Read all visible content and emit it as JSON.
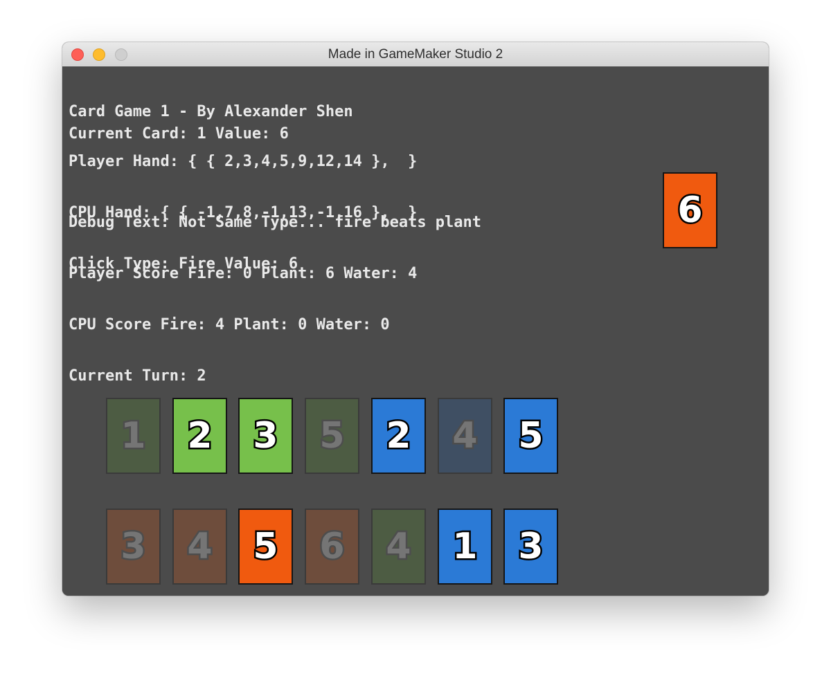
{
  "window": {
    "title": "Made in GameMaker Studio 2"
  },
  "hud": {
    "game_title": "Card Game 1 - By Alexander Shen",
    "current_card": "Current Card: 1 Value: 6",
    "player_hand": "Player Hand: { { 2,3,4,5,9,12,14 },  }",
    "cpu_hand": "CPU Hand: { { -1,7,8,-1,13,-1,16 },  }",
    "click_type": "Click Type: Fire Value: 6",
    "debug_text": "Debug Text: Not Same Type... fire beats plant",
    "player_score": "Player Score Fire: 0 Plant: 6 Water: 4",
    "cpu_score": "CPU Score Fire: 4 Plant: 0 Water: 0",
    "current_turn": "Current Turn: 2"
  },
  "colors": {
    "background": "#4b4b4b",
    "fire": "#f05a0f",
    "plant": "#77c04b",
    "water": "#2b7ad6",
    "fire_dim": "#6e4d3c",
    "plant_dim": "#4d5c43",
    "water_dim": "#3f4f63"
  },
  "played_card": {
    "type": "fire",
    "value": "6",
    "dimmed": false
  },
  "top_row_cards": [
    {
      "type": "plant",
      "value": "1",
      "dimmed": true
    },
    {
      "type": "plant",
      "value": "2",
      "dimmed": false
    },
    {
      "type": "plant",
      "value": "3",
      "dimmed": false
    },
    {
      "type": "plant",
      "value": "5",
      "dimmed": true
    },
    {
      "type": "water",
      "value": "2",
      "dimmed": false
    },
    {
      "type": "water",
      "value": "4",
      "dimmed": true
    },
    {
      "type": "water",
      "value": "5",
      "dimmed": false
    }
  ],
  "bottom_row_cards": [
    {
      "type": "fire",
      "value": "3",
      "dimmed": true
    },
    {
      "type": "fire",
      "value": "4",
      "dimmed": true
    },
    {
      "type": "fire",
      "value": "5",
      "dimmed": false
    },
    {
      "type": "fire",
      "value": "6",
      "dimmed": true
    },
    {
      "type": "plant",
      "value": "4",
      "dimmed": true
    },
    {
      "type": "water",
      "value": "1",
      "dimmed": false
    },
    {
      "type": "water",
      "value": "3",
      "dimmed": false
    }
  ]
}
